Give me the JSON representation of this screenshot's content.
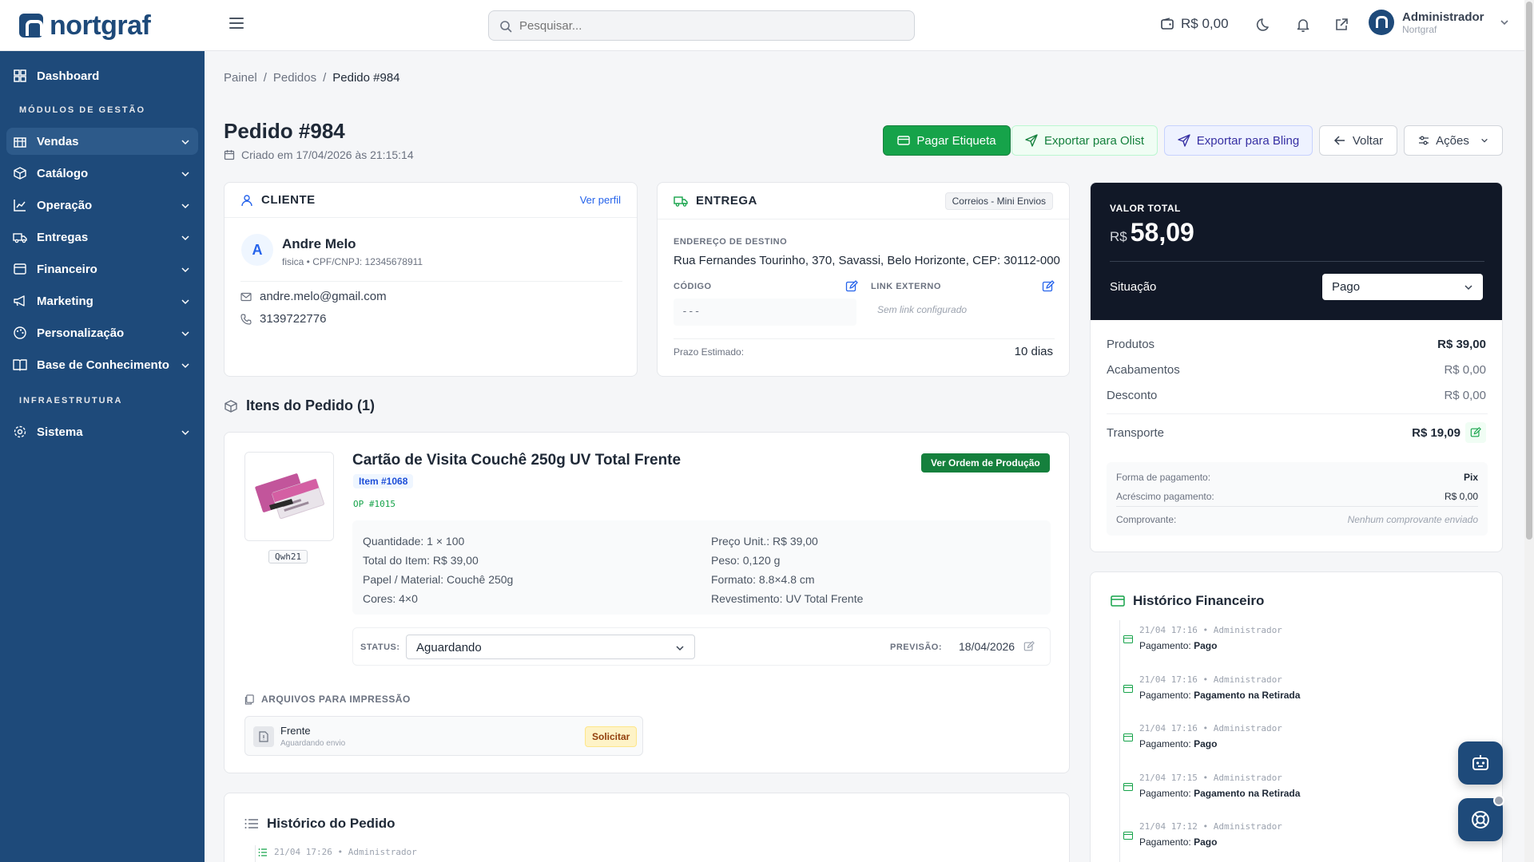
{
  "app": {
    "logo": "nortgraf"
  },
  "search": {
    "placeholder": "Pesquisar..."
  },
  "topbar": {
    "balance": "R$ 0,00",
    "user_name": "Administrador",
    "user_org": "Nortgraf"
  },
  "sidebar": {
    "dashboard": "Dashboard",
    "section_modules": "MÓDULOS DE GESTÃO",
    "items": [
      {
        "label": "Vendas",
        "icon": "store-icon"
      },
      {
        "label": "Catálogo",
        "icon": "box-icon"
      },
      {
        "label": "Operação",
        "icon": "chart-icon"
      },
      {
        "label": "Entregas",
        "icon": "truck-icon"
      },
      {
        "label": "Financeiro",
        "icon": "wallet-icon"
      },
      {
        "label": "Marketing",
        "icon": "megaphone-icon"
      },
      {
        "label": "Personalização",
        "icon": "palette-icon"
      },
      {
        "label": "Base de Conhecimento",
        "icon": "book-icon"
      }
    ],
    "section_infra": "INFRAESTRUTURA",
    "system": "Sistema"
  },
  "breadcrumb": {
    "home": "Painel",
    "orders": "Pedidos",
    "current": "Pedido #984"
  },
  "order": {
    "title": "Pedido #984",
    "created": "Criado em 17/04/2026 às 21:15:14"
  },
  "actions": {
    "pay_label": "Pagar Etiqueta",
    "olist": "Exportar para Olist",
    "bling": "Exportar para Bling",
    "back": "Voltar",
    "actions": "Ações"
  },
  "client": {
    "heading": "CLIENTE",
    "view_profile": "Ver perfil",
    "initial": "A",
    "name": "Andre Melo",
    "doc": "fisica • CPF/CNPJ: 12345678911",
    "email": "andre.melo@gmail.com",
    "phone": "3139722776"
  },
  "delivery": {
    "heading": "ENTREGA",
    "carrier": "Correios - Mini Envios",
    "address_label": "ENDEREÇO DE DESTINO",
    "address": "Rua Fernandes Tourinho, 370, Savassi, Belo Horizonte, CEP: 30112-000",
    "code_label": "CÓDIGO",
    "code_value": "---",
    "link_label": "LINK EXTERNO",
    "link_value": "Sem link configurado",
    "deadline_label": "Prazo Estimado:",
    "deadline_value": "10 dias"
  },
  "items_section": {
    "title": "Itens do Pedido (1)"
  },
  "item": {
    "thumb_code": "Qwh21",
    "name": "Cartão de Visita Couchê 250g UV Total Frente",
    "item_tag": "Item #1068",
    "op": "OP #1015",
    "production_button": "Ver Ordem de Produção",
    "quantity": "Quantidade: 1 × 100",
    "total": "Total do Item: R$ 39,00",
    "paper": "Papel / Material: Couchê 250g",
    "colors": "Cores: 4×0",
    "unit_price": "Preço Unit.: R$ 39,00",
    "weight": "Peso: 0,120 g",
    "format": "Formato: 8.8×4.8 cm",
    "coating": "Revestimento: UV Total Frente",
    "status_label": "STATUS:",
    "status_value": "Aguardando",
    "forecast_label": "PREVISÃO:",
    "forecast_value": "18/04/2026",
    "files_label": "ARQUIVOS PARA IMPRESSÃO",
    "file_name": "Frente",
    "file_status": "Aguardando envio",
    "request_button": "Solicitar"
  },
  "history_section": {
    "title": "Histórico do Pedido",
    "first_meta": "21/04 17:26 • Administrador"
  },
  "summary": {
    "total_label": "VALOR TOTAL",
    "currency": "R$",
    "total_value": "58,09",
    "status_label": "Situação",
    "status_value": "Pago",
    "products_label": "Produtos",
    "products_value": "R$ 39,00",
    "finishes_label": "Acabamentos",
    "finishes_value": "R$ 0,00",
    "discount_label": "Desconto",
    "discount_value": "R$ 0,00",
    "shipping_label": "Transporte",
    "shipping_value": "R$ 19,09",
    "payment_method_label": "Forma de pagamento:",
    "payment_method_value": "Pix",
    "payment_fee_label": "Acréscimo pagamento:",
    "payment_fee_value": "R$ 0,00",
    "receipt_label": "Comprovante:",
    "receipt_value": "Nenhum comprovante enviado"
  },
  "fin_history": {
    "title": "Histórico Financeiro",
    "entries": [
      {
        "meta": "21/04 17:16 • Administrador",
        "prefix": "Pagamento:",
        "value": "Pago"
      },
      {
        "meta": "21/04 17:16 • Administrador",
        "prefix": "Pagamento:",
        "value": "Pagamento na Retirada"
      },
      {
        "meta": "21/04 17:16 • Administrador",
        "prefix": "Pagamento:",
        "value": "Pago"
      },
      {
        "meta": "21/04 17:15 • Administrador",
        "prefix": "Pagamento:",
        "value": "Pagamento na Retirada"
      },
      {
        "meta": "21/04 17:12 • Administrador",
        "prefix": "Pagamento:",
        "value": "Pago"
      }
    ]
  },
  "colors": {
    "brand": "#1e4a7a",
    "success": "#16a34a",
    "dark_panel": "#111827"
  }
}
